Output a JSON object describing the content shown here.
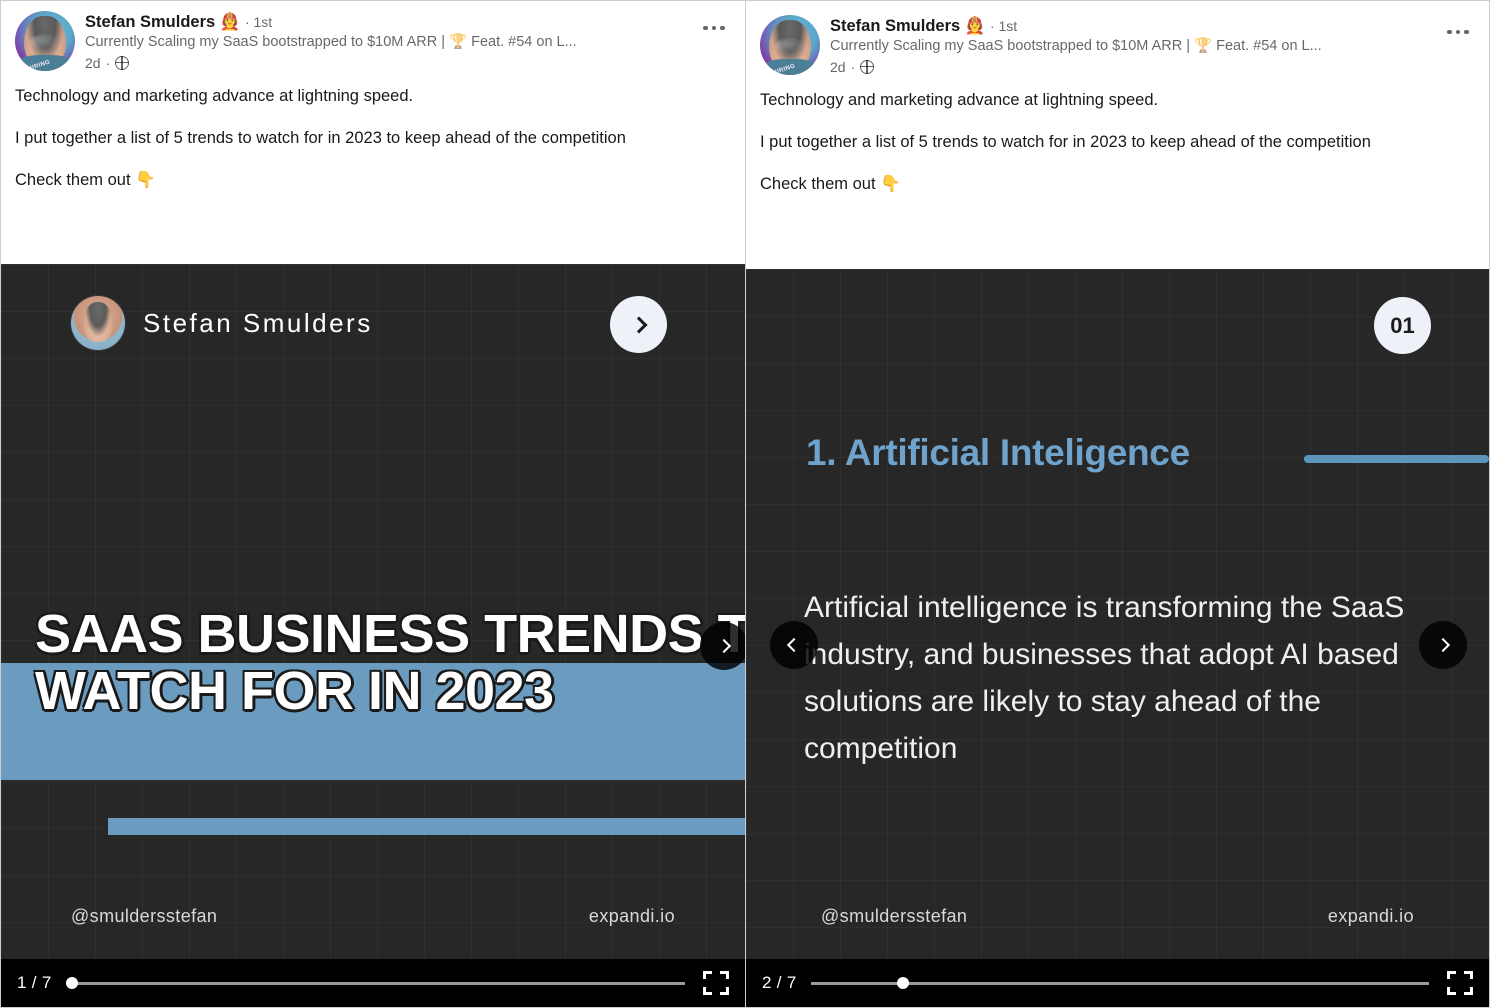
{
  "post": {
    "author_name": "Stefan Smulders",
    "author_badge_emoji": "🧑‍🚒",
    "connection_degree": "· 1st",
    "headline": "Currently Scaling my SaaS bootstrapped to $10M ARR | 🏆 Feat. #54 on L...",
    "time_ago": "2d",
    "visibility_icon": "globe-icon",
    "more_menu_icon": "ellipsis-icon",
    "avatar_ring_text": "#HIRING",
    "body": [
      "Technology and marketing advance at lightning speed.",
      "I put together a list of 5 trends to watch for in 2023 to keep ahead of the competition",
      "Check them out 👇"
    ]
  },
  "left_panel": {
    "slide": {
      "author_name": "Stefan Smulders",
      "circle_icon": "chevron-right-icon",
      "title_line1": "SAAS BUSINESS TRENDS TO",
      "title_line2": "WATCH FOR IN 2023",
      "handle": "@smuldersstefan",
      "brand": "expandi.io",
      "accent_color": "#6b9cc0",
      "background_color": "#272727"
    },
    "player": {
      "counter": "1 / 7",
      "progress_percent": 0,
      "fullscreen_icon": "fullscreen-icon",
      "next_icon": "chevron-right-icon"
    }
  },
  "right_panel": {
    "slide": {
      "badge_number": "01",
      "heading": "1. Artificial Inteligence",
      "body": "Artificial intelligence is transforming the SaaS industry, and businesses that adopt AI  based solutions are likely to stay ahead of the competition",
      "handle": "@smuldersstefan",
      "brand": "expandi.io",
      "accent_color": "#6fa3cb",
      "underline_color": "#5e95bd",
      "background_color": "#272727"
    },
    "player": {
      "counter": "2 / 7",
      "progress_percent": 14,
      "fullscreen_icon": "fullscreen-icon",
      "prev_icon": "chevron-left-icon",
      "next_icon": "chevron-right-icon"
    }
  }
}
